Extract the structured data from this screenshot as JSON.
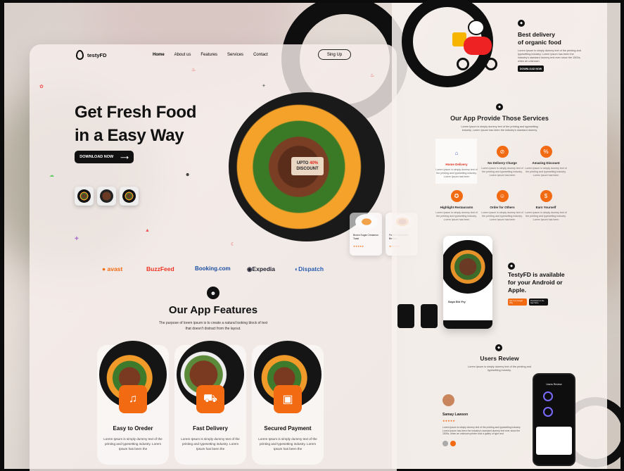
{
  "brand": {
    "name": "testyFD"
  },
  "nav": {
    "items": [
      "Home",
      "About us",
      "Features",
      "Services",
      "Contact"
    ],
    "signup": "Sing Up"
  },
  "hero": {
    "line1": "Get Fresh Food",
    "line2": "in a Easy Way",
    "cta": "DOWNLOAD NOW",
    "badge_line1": "UPTO",
    "badge_pct": "40%",
    "badge_line2": "DISCOUNT"
  },
  "partners": [
    "avast",
    "BuzzFeed",
    "Booking.com",
    "Expedia",
    "Dispatch"
  ],
  "mini_cards": [
    {
      "title": "Brown Sugar Cinnamon Toast",
      "stars": "★★★★★"
    },
    {
      "title": "French Toast with Berries",
      "stars": "★★★★★"
    }
  ],
  "features": {
    "title": "Our App Features",
    "subtitle": "The purpose of lorem ipsum is to create a natural looking block of text that doesn't distract from the layout.",
    "cards": [
      {
        "title": "Easy to Oreder",
        "text": "Lorem Ipsum is simply dummy text of the printing and typesetting industry. Lorem Ipsum has been the"
      },
      {
        "title": "Fast Delivery",
        "text": "Lorem Ipsum is simply dummy text of the printing and typesetting industry. Lorem Ipsum has been the"
      },
      {
        "title": "Secured Payment",
        "text": "Lorem Ipsum is simply dummy text of the printing and typesetting industry. Lorem Ipsum has been the"
      }
    ]
  },
  "delivery": {
    "title_line1": "Best delivery",
    "title_line2": "of organic food",
    "text": "Lorem Ipsum is simply dummy text of the printing and typesetting industry. Lorem Ipsum has been the industry's standard dummy text ever since the 1500s, when an unknown",
    "button": "DOWNLOAD NOW"
  },
  "services": {
    "title": "Our App Provide Those Services",
    "subtitle": "Lorem Ipsum is simply dummy text of the printing and typesetting industry. Lorem Ipsum has been the industry's standard dummy",
    "items": [
      {
        "title": "Home Delivery",
        "text": "Lorem Ipsum is simply dummy text of the printing and typesetting industry. Lorem Ipsum has been"
      },
      {
        "title": "No Delivery Charge",
        "text": "Lorem Ipsum is simply dummy text of the printing and typesetting industry. Lorem Ipsum has been"
      },
      {
        "title": "Amazing Discount",
        "text": "Lorem Ipsum is simply dummy text of the printing and typesetting industry. Lorem Ipsum has been"
      },
      {
        "title": "Highlight Restaurants",
        "text": "Lorem Ipsum is simply dummy text of the printing and typesetting industry. Lorem Ipsum has been"
      },
      {
        "title": "Order for Others",
        "text": "Lorem Ipsum is simply dummy text of the printing and typesetting industry. Lorem Ipsum has been"
      },
      {
        "title": "Earn Yourself",
        "text": "Lorem Ipsum is simply dummy text of the printing and typesetting industry. Lorem Ipsum has been"
      }
    ]
  },
  "app": {
    "title_line1": "TestyFD is available",
    "title_line2": "for your Android or",
    "title_line3": "Apple.",
    "phone_item": "Soya Stir Fry",
    "google": "Get it on Google Play",
    "apple": "Download on the App Store"
  },
  "reviews": {
    "title": "Users Review",
    "subtitle": "Lorem Ipsum is simply dummy text of the printing and typesetting industry.",
    "name": "Samay Lawson",
    "text": "Lorem Ipsum is simply dummy text of the printing and typesetting industry. Lorem Ipsum has been the industry's standard dummy text ever since the 1500s, when an unknown printer took a galley of type and",
    "phone_title": "Users Review"
  },
  "colors": {
    "accent": "#f26a12",
    "dark": "#111111"
  }
}
